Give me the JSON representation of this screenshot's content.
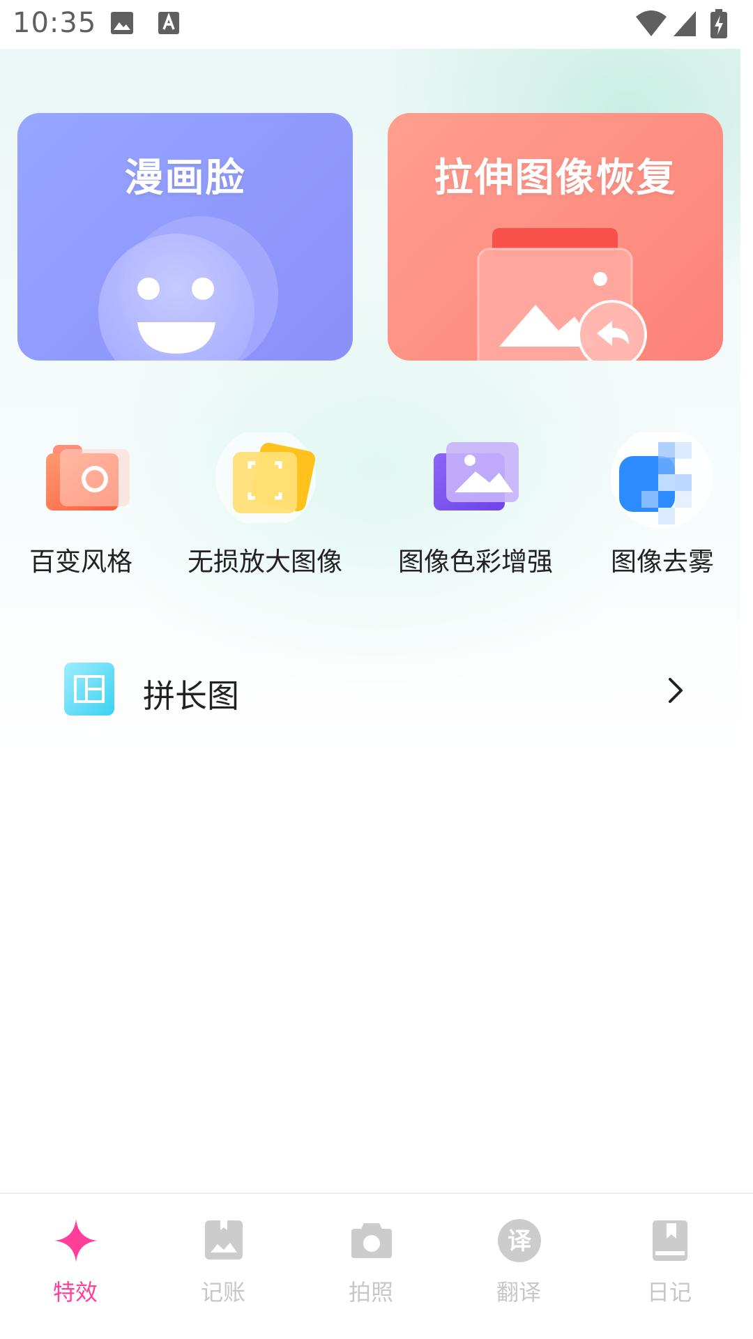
{
  "status_bar": {
    "time": "10:35"
  },
  "cards": [
    {
      "title": "漫画脸",
      "color": "#8e97fb"
    },
    {
      "title": "拉伸图像恢复",
      "color": "#fe8c82"
    }
  ],
  "tools": [
    {
      "label": "百变风格"
    },
    {
      "label": "无损放大图像"
    },
    {
      "label": "图像色彩增强"
    },
    {
      "label": "图像去雾"
    }
  ],
  "list": [
    {
      "label": "拼长图"
    }
  ],
  "bottom_nav": {
    "active_color": "#ff3f9a",
    "items": [
      {
        "label": "特效",
        "icon": "sparkle-icon",
        "active": true
      },
      {
        "label": "记账",
        "icon": "bookmark-photo-icon",
        "active": false
      },
      {
        "label": "拍照",
        "icon": "camera-icon",
        "active": false
      },
      {
        "label": "翻译",
        "icon": "translate-icon",
        "glyph": "译",
        "active": false
      },
      {
        "label": "日记",
        "icon": "diary-book-icon",
        "active": false
      }
    ]
  }
}
